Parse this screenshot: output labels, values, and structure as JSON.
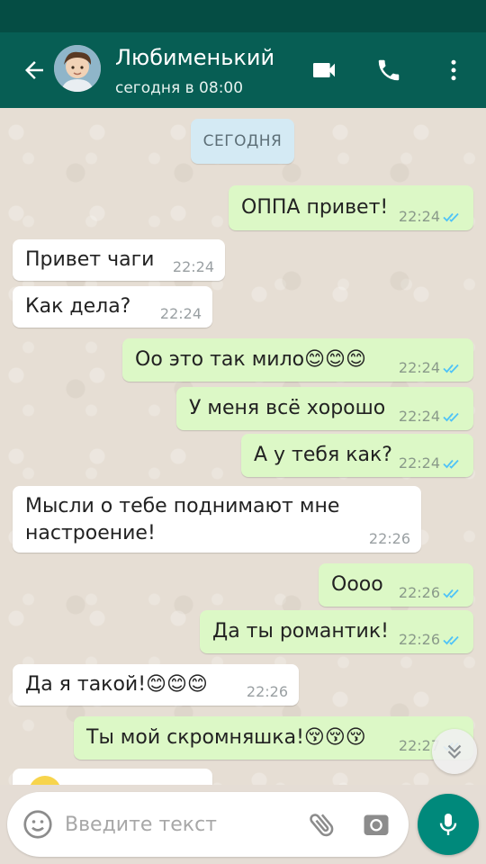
{
  "header": {
    "contact_name": "Любименький",
    "contact_status": "сегодня в 08:00",
    "icons": [
      "back-arrow-icon",
      "video-call-icon",
      "phone-icon",
      "more-vert-icon"
    ],
    "accent_color": "#075e54"
  },
  "chat": {
    "date_chip": "СЕГОДНЯ",
    "messages": [
      {
        "text": "ОППА привет!",
        "time": "22:24",
        "direction": "out",
        "status": "read"
      },
      {
        "text": "Привет чаги",
        "time": "22:24",
        "direction": "in"
      },
      {
        "text": "Как дела?",
        "time": "22:24",
        "direction": "in"
      },
      {
        "text": "Оо это так мило😊😊😊",
        "time": "22:24",
        "direction": "out",
        "status": "read"
      },
      {
        "text": "У меня всё хорошо",
        "time": "22:24",
        "direction": "out",
        "status": "read"
      },
      {
        "text": "А у тебя как?",
        "time": "22:24",
        "direction": "out",
        "status": "read"
      },
      {
        "text": "Мысли о тебе поднимают мне настроение!",
        "time": "22:26",
        "direction": "in"
      },
      {
        "text": "Оооо",
        "time": "22:26",
        "direction": "out",
        "status": "read"
      },
      {
        "text": "Да ты романтик!",
        "time": "22:26",
        "direction": "out",
        "status": "read"
      },
      {
        "text": "Да я такой!😊😊😊",
        "time": "22:26",
        "direction": "in"
      },
      {
        "text": "Ты мой скромняшка!😚😚😚",
        "time": "22:27",
        "direction": "out",
        "status": "read"
      }
    ],
    "outgoing_color": "#dcf8c6",
    "incoming_color": "#ffffff",
    "read_tick_color": "#4fc3f7"
  },
  "composer": {
    "placeholder": "Введите текст",
    "icons": [
      "emoji-icon",
      "attach-icon",
      "camera-icon",
      "mic-icon"
    ],
    "mic_button_color": "#00897b"
  }
}
